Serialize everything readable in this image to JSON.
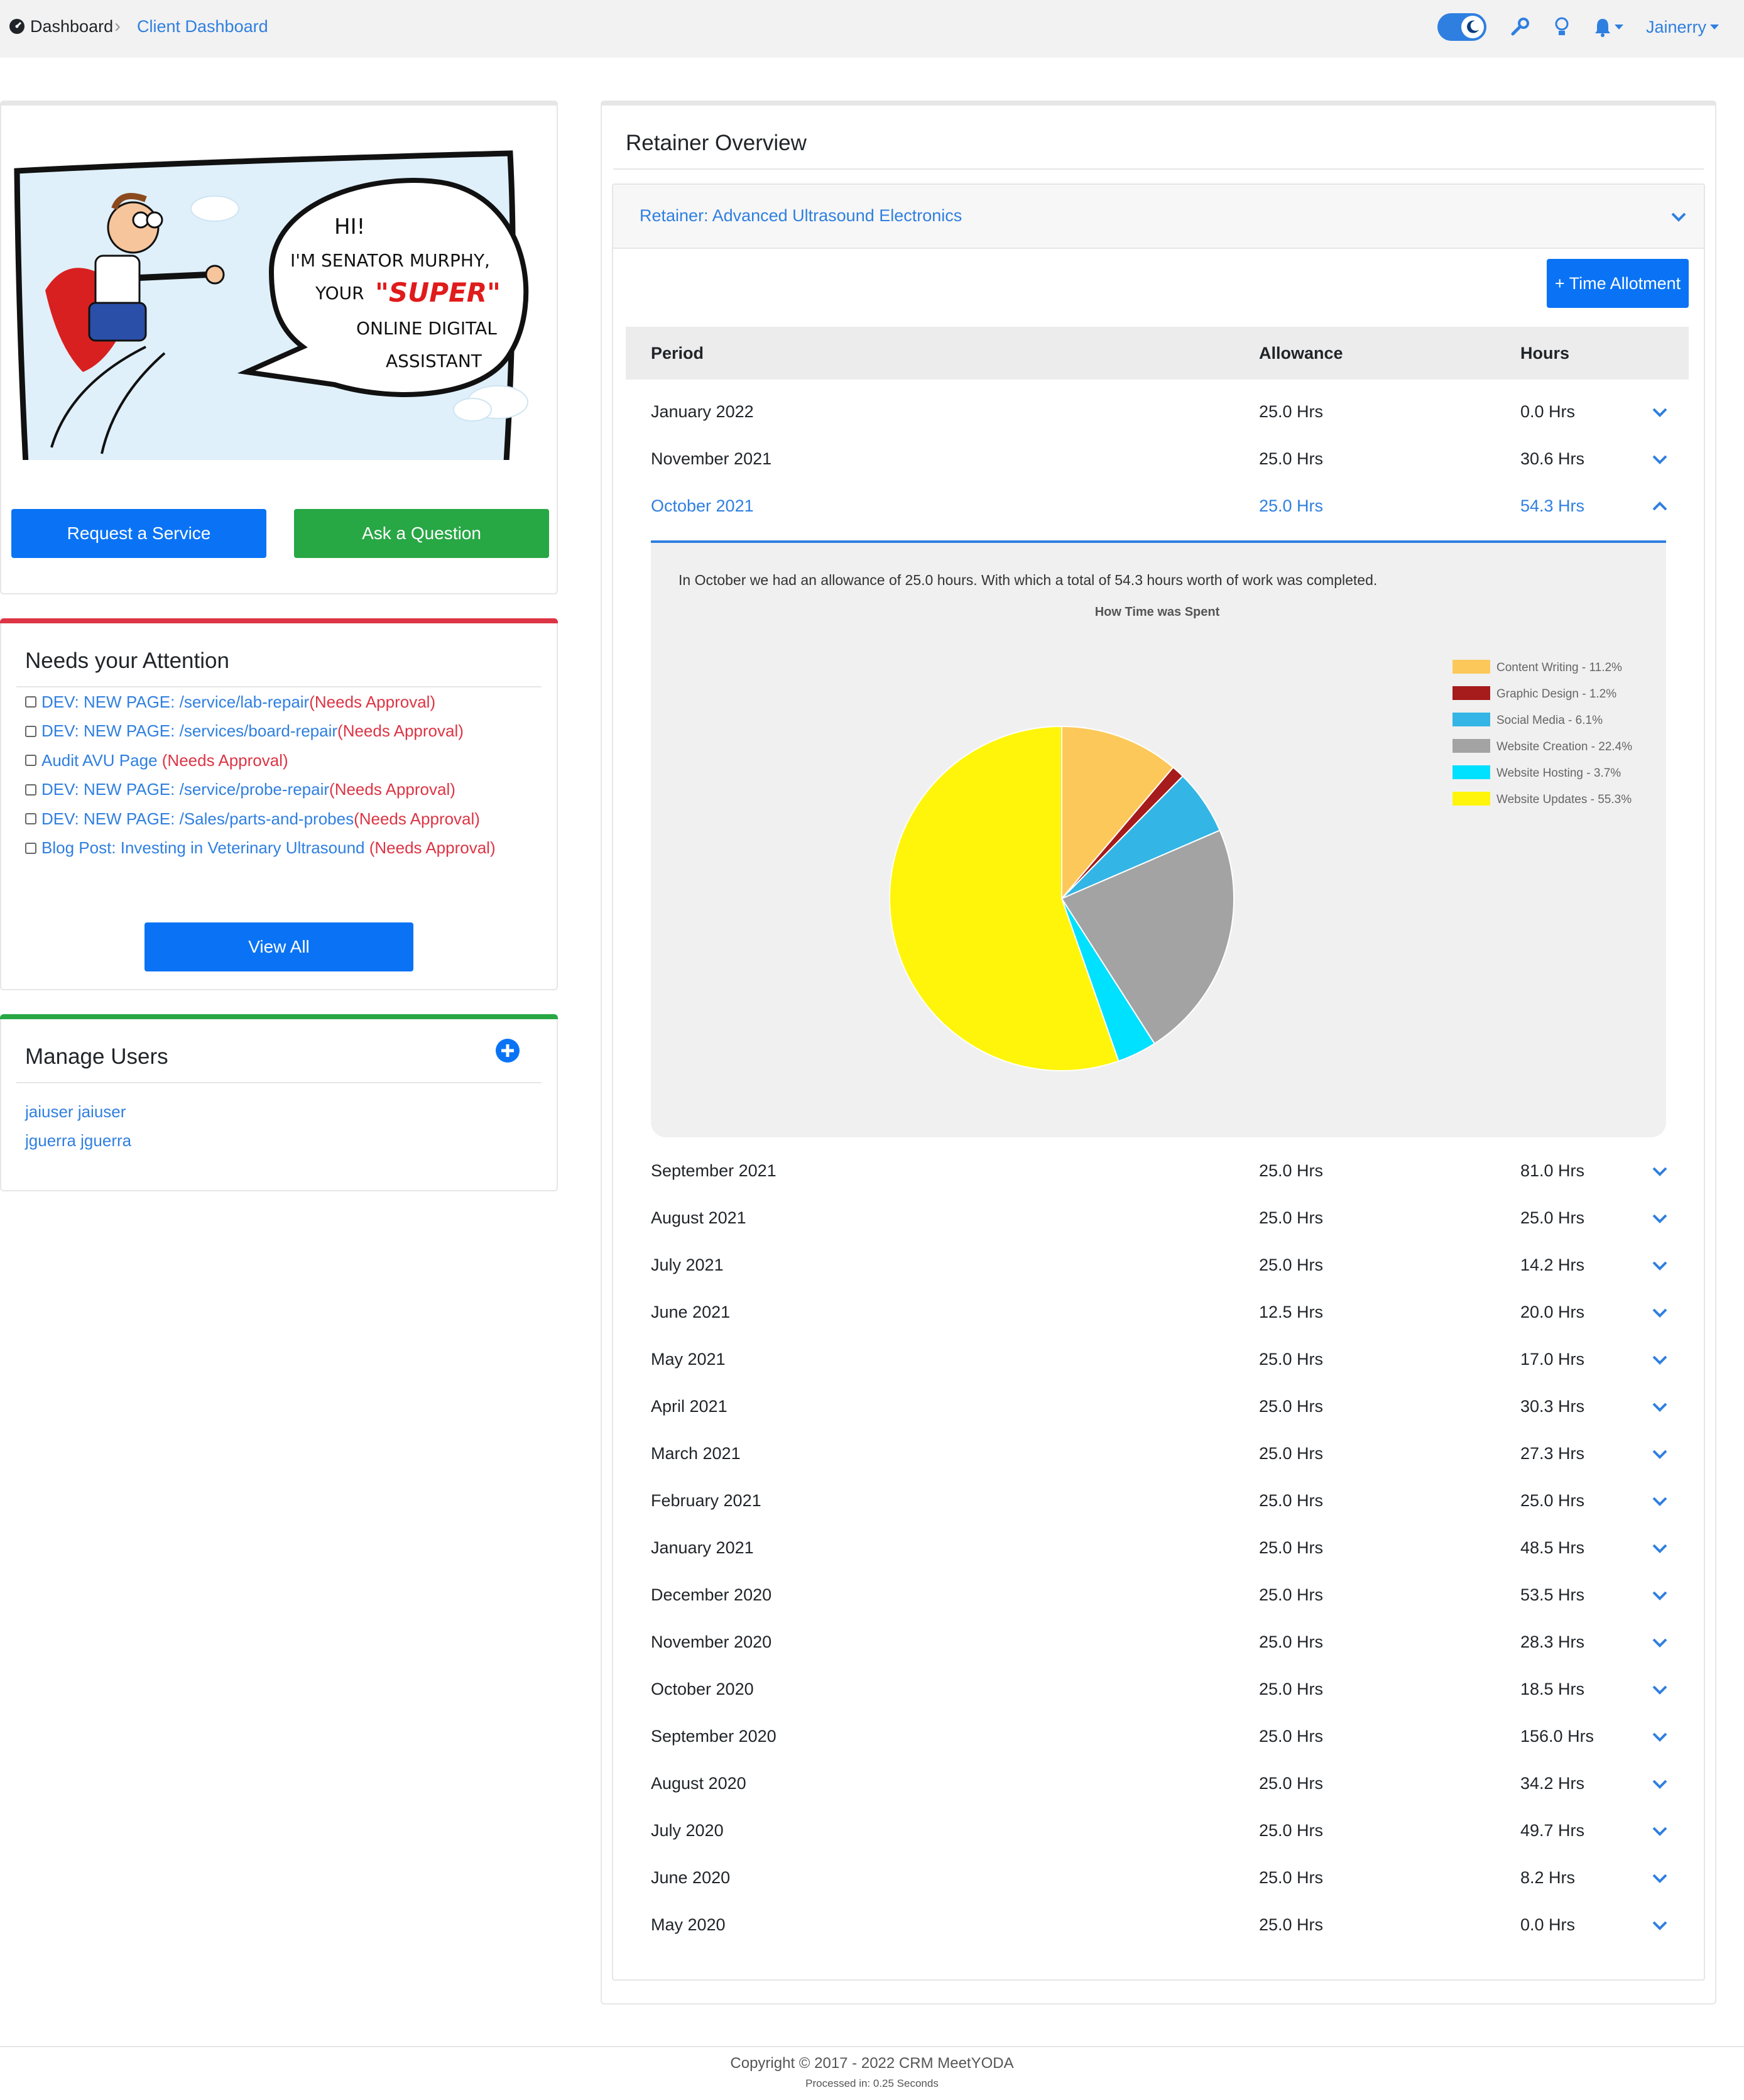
{
  "breadcrumb": {
    "home": "Dashboard",
    "current": "Client Dashboard"
  },
  "header": {
    "user": "Jainerry"
  },
  "hero": {
    "speech_lines": [
      "HI!",
      "I'M SENATOR MURPHY,",
      "YOUR",
      "\"SUPER\"",
      "ONLINE DIGITAL",
      "ASSISTANT"
    ],
    "request_label": "Request a Service",
    "question_label": "Ask a Question"
  },
  "attention": {
    "title": "Needs your Attention",
    "items": [
      {
        "link": "DEV: NEW PAGE: /service/lab-repair",
        "status": "(Needs Approval)"
      },
      {
        "link": "DEV: NEW PAGE: /services/board-repair",
        "status": "(Needs Approval)"
      },
      {
        "link": "Audit AVU Page",
        "status": " (Needs Approval)"
      },
      {
        "link": "DEV: NEW PAGE: /service/probe-repair",
        "status": "(Needs Approval)"
      },
      {
        "link": "DEV: NEW PAGE: /Sales/parts-and-probes",
        "status": "(Needs Approval)"
      },
      {
        "link": "Blog Post: Investing in Veterinary Ultrasound",
        "status": " (Needs Approval)"
      }
    ],
    "view_all_label": "View All"
  },
  "manage_users": {
    "title": "Manage Users",
    "users": [
      "jaiuser jaiuser",
      "jguerra jguerra"
    ]
  },
  "retainer": {
    "title": "Retainer Overview",
    "accordion_label": "Retainer: Advanced Ultrasound Electronics",
    "time_allotment_label": "+ Time Allotment",
    "columns": [
      "Period",
      "Allowance",
      "Hours"
    ],
    "rows_before": [
      {
        "period": "January 2022",
        "allowance": "25.0 Hrs",
        "hours": "0.0 Hrs"
      },
      {
        "period": "November 2021",
        "allowance": "25.0 Hrs",
        "hours": "30.6 Hrs"
      }
    ],
    "active_row": {
      "period": "October 2021",
      "allowance": "25.0 Hrs",
      "hours": "54.3 Hrs"
    },
    "detail_text": "In October we had an allowance of 25.0 hours. With which a total of 54.3 hours worth of work was completed.",
    "rows_after": [
      {
        "period": "September 2021",
        "allowance": "25.0 Hrs",
        "hours": "81.0 Hrs"
      },
      {
        "period": "August 2021",
        "allowance": "25.0 Hrs",
        "hours": "25.0 Hrs"
      },
      {
        "period": "July 2021",
        "allowance": "25.0 Hrs",
        "hours": "14.2 Hrs"
      },
      {
        "period": "June 2021",
        "allowance": "12.5 Hrs",
        "hours": "20.0 Hrs"
      },
      {
        "period": "May 2021",
        "allowance": "25.0 Hrs",
        "hours": "17.0 Hrs"
      },
      {
        "period": "April 2021",
        "allowance": "25.0 Hrs",
        "hours": "30.3 Hrs"
      },
      {
        "period": "March 2021",
        "allowance": "25.0 Hrs",
        "hours": "27.3 Hrs"
      },
      {
        "period": "February 2021",
        "allowance": "25.0 Hrs",
        "hours": "25.0 Hrs"
      },
      {
        "period": "January 2021",
        "allowance": "25.0 Hrs",
        "hours": "48.5 Hrs"
      },
      {
        "period": "December 2020",
        "allowance": "25.0 Hrs",
        "hours": "53.5 Hrs"
      },
      {
        "period": "November 2020",
        "allowance": "25.0 Hrs",
        "hours": "28.3 Hrs"
      },
      {
        "period": "October 2020",
        "allowance": "25.0 Hrs",
        "hours": "18.5 Hrs"
      },
      {
        "period": "September 2020",
        "allowance": "25.0 Hrs",
        "hours": "156.0 Hrs"
      },
      {
        "period": "August 2020",
        "allowance": "25.0 Hrs",
        "hours": "34.2 Hrs"
      },
      {
        "period": "July 2020",
        "allowance": "25.0 Hrs",
        "hours": "49.7 Hrs"
      },
      {
        "period": "June 2020",
        "allowance": "25.0 Hrs",
        "hours": "8.2 Hrs"
      },
      {
        "period": "May 2020",
        "allowance": "25.0 Hrs",
        "hours": "0.0 Hrs"
      }
    ]
  },
  "chart_data": {
    "type": "pie",
    "title": "How Time was Spent",
    "legend_position": "right",
    "slices": [
      {
        "label": "Content Writing",
        "value": 11.2,
        "color": "#fdc85a"
      },
      {
        "label": "Graphic Design",
        "value": 1.2,
        "color": "#a61b1b"
      },
      {
        "label": "Social Media",
        "value": 6.1,
        "color": "#33b5e5"
      },
      {
        "label": "Website Creation",
        "value": 22.4,
        "color": "#a3a3a3"
      },
      {
        "label": "Website Hosting",
        "value": 3.7,
        "color": "#00e0ff"
      },
      {
        "label": "Website Updates",
        "value": 55.3,
        "color": "#fff50a"
      }
    ],
    "legend_labels": [
      "Content Writing - 11.2%",
      "Graphic Design - 1.2%",
      "Social Media - 6.1%",
      "Website Creation - 22.4%",
      "Website Hosting - 3.7%",
      "Website Updates - 55.3%"
    ]
  },
  "footer": {
    "copyright": "Copyright © 2017 - 2022 CRM MeetYODA",
    "processed": "Processed in: 0.25 Seconds"
  },
  "colors": {
    "primary": "#0a73f5",
    "success": "#28a745",
    "danger": "#dc3545",
    "link": "#2f7fe0"
  },
  "icons": [
    "dashboard-icon",
    "chevron-right-icon",
    "dark-mode-toggle",
    "moon-icon",
    "wrench-icon",
    "lightbulb-icon",
    "bell-icon",
    "caret-down-icon",
    "chevron-down-icon",
    "chevron-up-icon",
    "plus-circle-icon"
  ]
}
